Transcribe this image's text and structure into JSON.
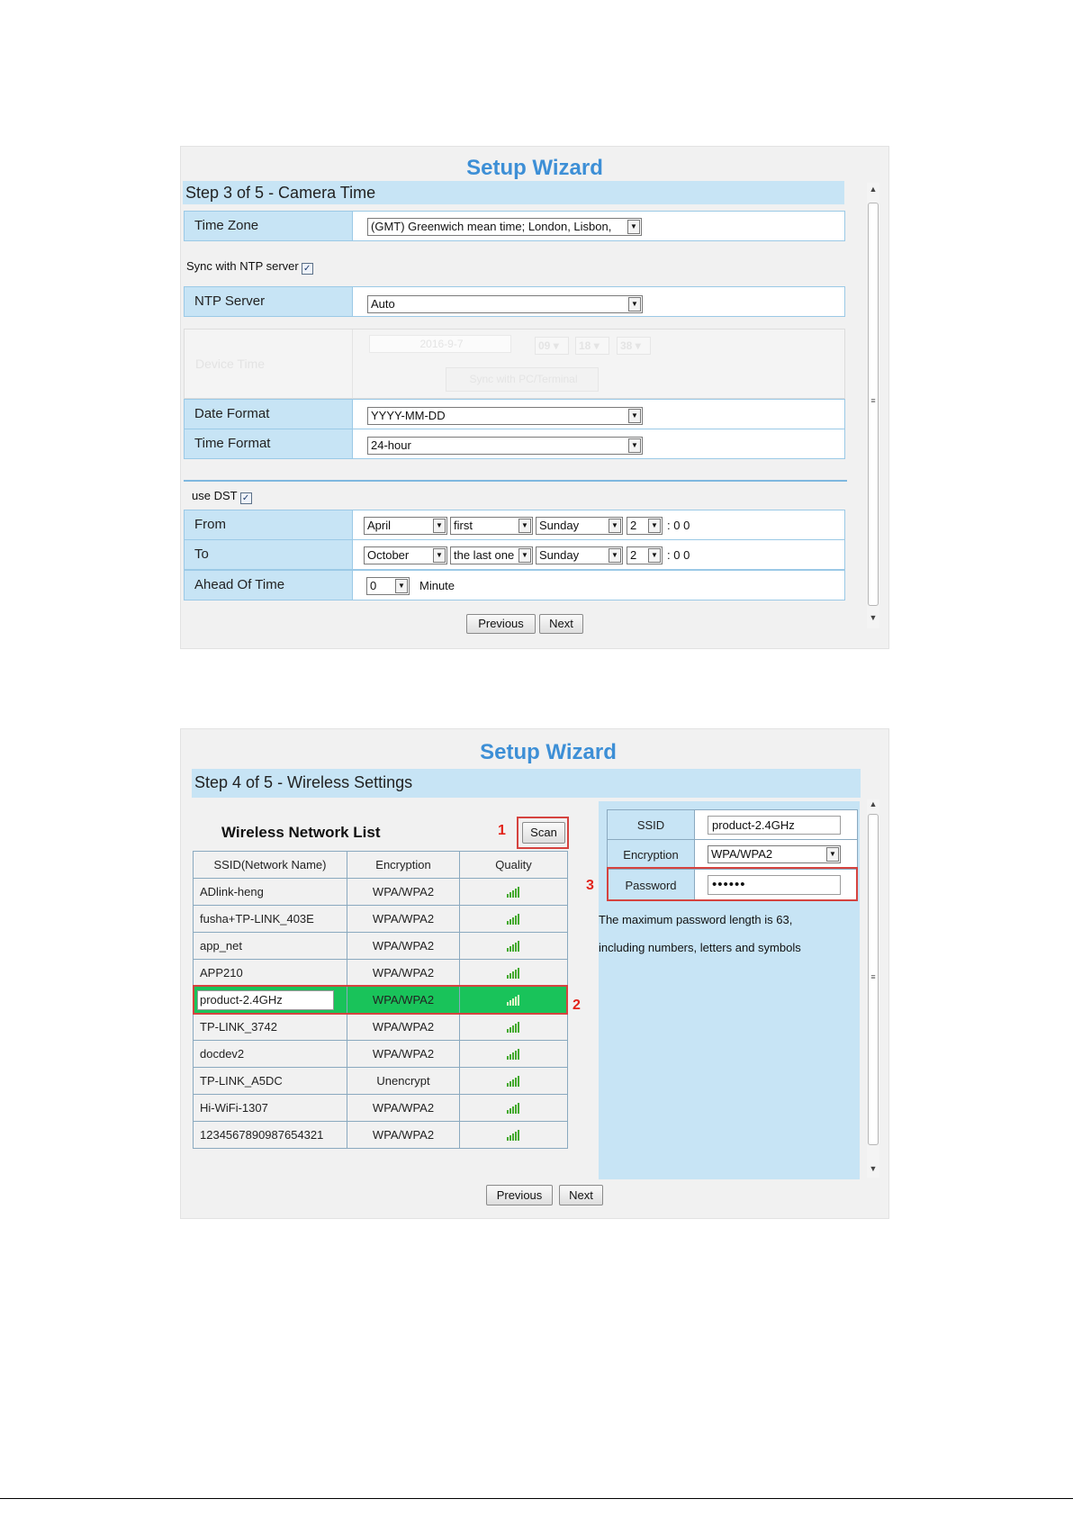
{
  "wizard1": {
    "title": "Setup Wizard",
    "step": "Step 3 of 5 - Camera Time",
    "time_zone": {
      "label": "Time Zone",
      "value": "(GMT) Greenwich mean time; London, Lisbon,"
    },
    "sync_ntp_label": "Sync with NTP server",
    "ntp_server": {
      "label": "NTP Server",
      "value": "Auto"
    },
    "device_time": {
      "label": "Device Time",
      "date": "2016-9-7",
      "hour": "09",
      "minute": "18",
      "second": "38",
      "sync_button": "Sync with PC/Terminal"
    },
    "date_format": {
      "label": "Date Format",
      "value": "YYYY-MM-DD"
    },
    "time_format": {
      "label": "Time Format",
      "value": "24-hour"
    },
    "use_dst_label": "use DST",
    "from": {
      "label": "From",
      "month": "April",
      "week": "first",
      "day": "Sunday",
      "hour": "2",
      "suffix": ": 0 0"
    },
    "to": {
      "label": "To",
      "month": "October",
      "week": "the last one",
      "day": "Sunday",
      "hour": "2",
      "suffix": ": 0 0"
    },
    "ahead": {
      "label": "Ahead Of Time",
      "value": "0",
      "unit": "Minute"
    },
    "prev_button": "Previous",
    "next_button": "Next"
  },
  "wizard2": {
    "title": "Setup Wizard",
    "step": "Step 4 of 5 - Wireless Settings",
    "list_title": "Wireless Network List",
    "scan_button": "Scan",
    "columns": [
      "SSID(Network Name)",
      "Encryption",
      "Quality"
    ],
    "networks": [
      {
        "ssid": "ADlink-heng",
        "enc": "WPA/WPA2"
      },
      {
        "ssid": "fusha+TP-LINK_403E",
        "enc": "WPA/WPA2"
      },
      {
        "ssid": "app_net",
        "enc": "WPA/WPA2"
      },
      {
        "ssid": "APP210",
        "enc": "WPA/WPA2"
      },
      {
        "ssid": "product-2.4GHz",
        "enc": "WPA/WPA2"
      },
      {
        "ssid": "TP-LINK_3742",
        "enc": "WPA/WPA2"
      },
      {
        "ssid": "docdev2",
        "enc": "WPA/WPA2"
      },
      {
        "ssid": "TP-LINK_A5DC",
        "enc": "Unencrypt"
      },
      {
        "ssid": "Hi-WiFi-1307",
        "enc": "WPA/WPA2"
      },
      {
        "ssid": "1234567890987654321",
        "enc": "WPA/WPA2"
      }
    ],
    "selected_index": 4,
    "ssid_label": "SSID",
    "ssid_value": "product-2.4GHz",
    "encryption_label": "Encryption",
    "encryption_value": "WPA/WPA2",
    "password_label": "Password",
    "password_value": "••••••",
    "note_line1": "The maximum password length is 63,",
    "note_line2": "including numbers, letters and symbols",
    "markers": [
      "1",
      "2",
      "3"
    ],
    "prev_button": "Previous",
    "next_button": "Next"
  },
  "colors": {
    "title": "#3d8fd6",
    "label_bg": "#c7e4f5",
    "selected_row": "#19c35a",
    "marker": "#e2231a"
  }
}
